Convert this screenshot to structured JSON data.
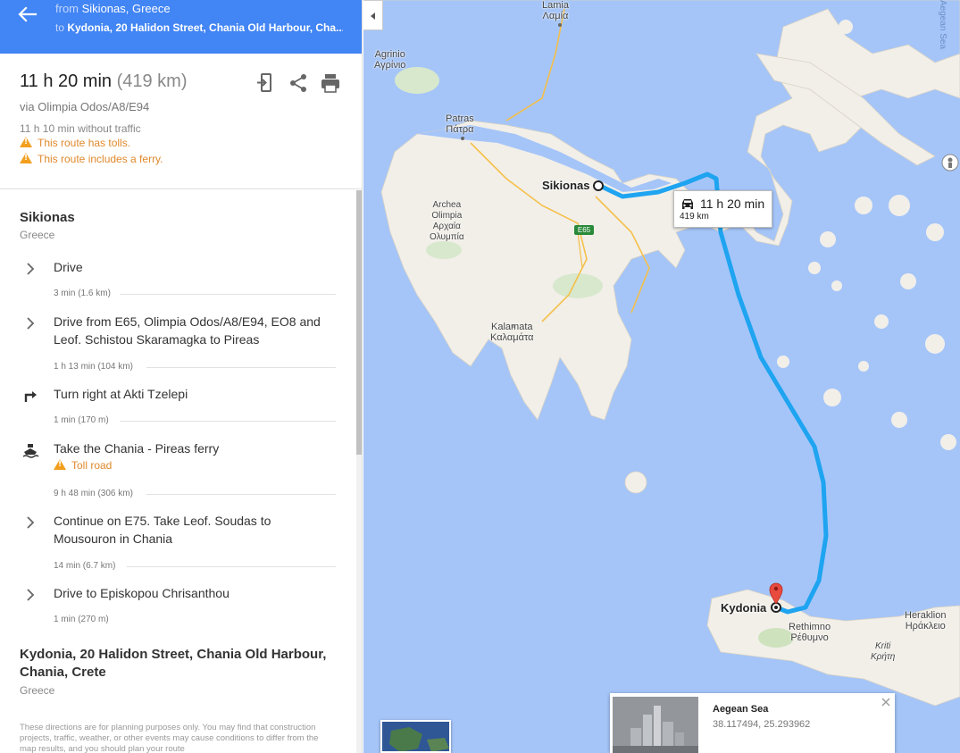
{
  "header": {
    "from_prefix": "from ",
    "from_place": "Sikionas, Greece",
    "to_prefix": "to ",
    "to_place": "Kydonia, 20 Halidon Street, Chania Old Harbour, Cha..."
  },
  "summary": {
    "duration": "11 h 20 min",
    "distance": "(419 km)",
    "via": "via Olimpia Odos/A8/E94",
    "no_traffic": "11 h 10 min without traffic",
    "tolls_warning": "This route has tolls.",
    "ferry_warning": "This route includes a ferry."
  },
  "origin": {
    "name": "Sikionas",
    "country": "Greece"
  },
  "steps": [
    {
      "icon": "chevron-right-icon",
      "text": "Drive",
      "meta": "3 min (1.6 km)"
    },
    {
      "icon": "chevron-right-icon",
      "text": "Drive from E65, Olimpia Odos/A8/E94, EO8 and Leof. Schistou Skaramagka to Pireas",
      "meta": "1 h 13 min (104 km)"
    },
    {
      "icon": "turn-right-icon",
      "text": "Turn right at Akti Tzelepi",
      "meta": "1 min (170 m)"
    },
    {
      "icon": "ferry-icon",
      "text": "Take the Chania - Pireas ferry",
      "toll": "Toll road",
      "meta": "9 h 48 min (306 km)"
    },
    {
      "icon": "chevron-right-icon",
      "text": "Continue on E75. Take Leof. Soudas to Mousouron in Chania",
      "meta": "14 min (6.7 km)"
    },
    {
      "icon": "chevron-right-icon",
      "text": "Drive to Episkopou Chrisanthou",
      "meta": "1 min (270 m)"
    }
  ],
  "destination": {
    "name": "Kydonia, 20 Halidon Street, Chania Old Harbour, Chania, Crete",
    "country": "Greece"
  },
  "disclaimer": "These directions are for planning purposes only. You may find that construction projects, traffic, weather, or other events may cause conditions to differ from the map results, and you should plan your route",
  "map": {
    "labels": {
      "lamia": "Lamia",
      "lamia_gr": "Λαμία",
      "agrinio": "Agrinio",
      "agrinio_gr": "Αγρίνιο",
      "patras": "Patras",
      "patras_gr": "Πάτρα",
      "archea": "Archea",
      "olimpia": "Olimpia",
      "archaia_gr": "Αρχαία",
      "olympia_gr": "Ολυμπία",
      "kalamata": "Kalamata",
      "kalamata_gr": "Καλαμάτα",
      "rethimno": "Rethimno",
      "rethimno_gr": "Ρέθυμνο",
      "heraklion": "Heraklion",
      "heraklion_gr": "Ηράκλειο",
      "kriti": "Kriti",
      "kriti_gr": "Κρήτη",
      "aegean_sea_edge": "Aegean Sea",
      "e65": "E65",
      "sikionas": "Sikionas",
      "kydonia": "Kydonia"
    },
    "route_callout": {
      "time": "11 h 20 min",
      "distance": "419 km"
    },
    "info_card": {
      "title": "Aegean Sea",
      "coords": "38.117494, 25.293962"
    },
    "colors": {
      "water": "#a5c5f8",
      "land": "#f2efe9",
      "route": "#1ea4f0",
      "header_blue": "#4285f4",
      "warning": "#e0892d"
    }
  }
}
